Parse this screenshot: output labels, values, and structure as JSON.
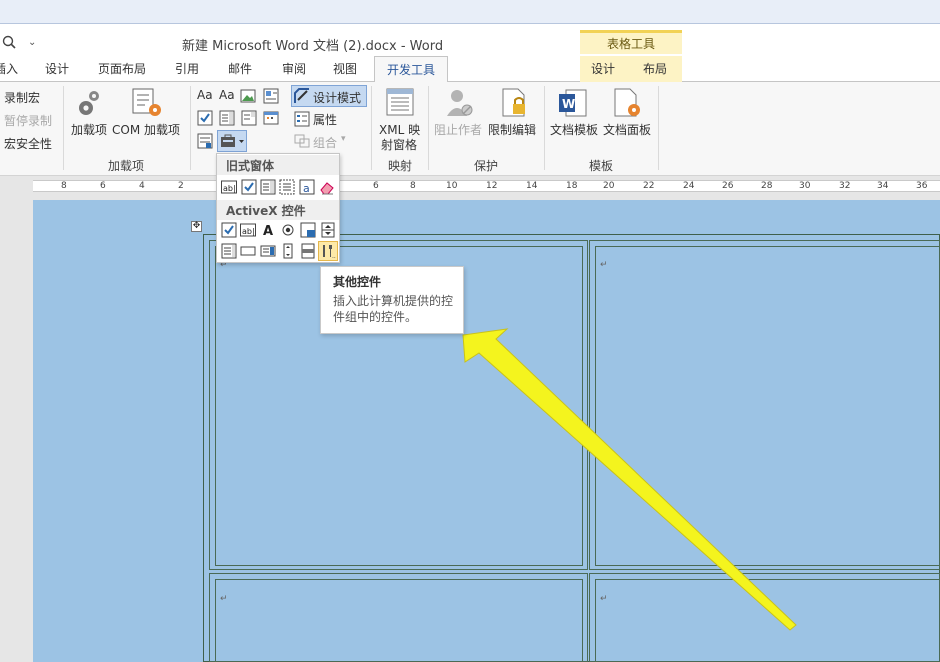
{
  "window": {
    "title": "新建 Microsoft Word 文档 (2).docx - Word"
  },
  "context_tab_group": "表格工具",
  "tabs": [
    "插入",
    "设计",
    "页面布局",
    "引用",
    "邮件",
    "审阅",
    "视图",
    "开发工具"
  ],
  "active_tab": "开发工具",
  "context_tabs": [
    "设计",
    "布局"
  ],
  "ribbon": {
    "code": {
      "record_macro": "录制宏",
      "pause_recording": "暂停录制",
      "macro_security": "宏安全性"
    },
    "addins": {
      "addins_button": "加载项",
      "com_addins_button": "COM 加载项",
      "group_label": "加载项"
    },
    "controls": {
      "design_mode": "设计模式",
      "properties": "属性",
      "group": "组合",
      "rich_text": "Aa",
      "plain_text": "Aa"
    },
    "mapping": {
      "xml_pane": "XML 映射窗格",
      "xml_line1": "XML 映",
      "xml_line2": "射窗格",
      "group_label": "映射"
    },
    "protect": {
      "block_authors": "阻止作者",
      "restrict_editing": "限制编辑",
      "group_label": "保护"
    },
    "templates": {
      "document_template": "文档模板",
      "document_panel": "文档面板",
      "group_label": "模板"
    }
  },
  "dropdown": {
    "legacy_header": "旧式窗体",
    "activex_header": "ActiveX 控件"
  },
  "tooltip": {
    "title": "其他控件",
    "description": "插入此计算机提供的控件组中的控件。"
  },
  "ruler": [
    "8",
    "6",
    "4",
    "2",
    "2",
    "4",
    "6",
    "8",
    "10",
    "12",
    "14",
    "16",
    "18",
    "20",
    "22",
    "24",
    "26",
    "28",
    "30",
    "32",
    "34",
    "36"
  ],
  "colors": {
    "accent": "#2b579a",
    "page": "#9cc3e4",
    "arrow": "#f4f41e",
    "context": "#fdf3c5"
  }
}
